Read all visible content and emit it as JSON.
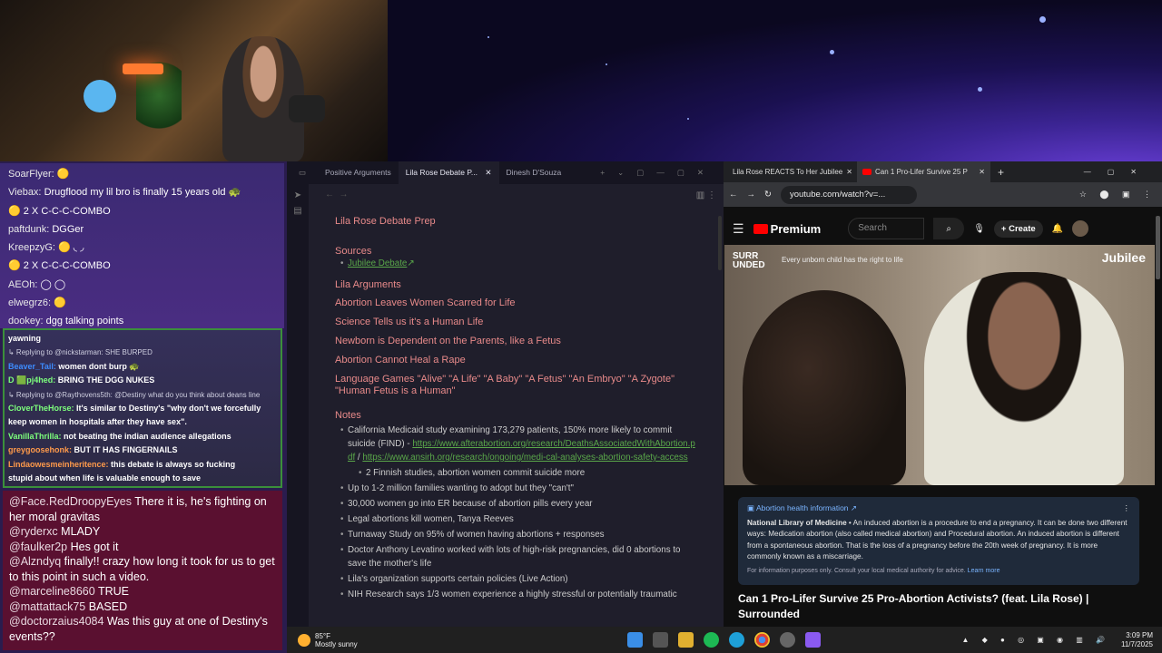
{
  "chat_top": [
    {
      "user": "SoarFlyer:",
      "msg": "🟡"
    },
    {
      "user": "Viebax:",
      "msg": "Drugflood my lil bro is finally 15 years old 🐢"
    },
    {
      "user": "",
      "msg": "🟡 2 X C-C-C-COMBO"
    },
    {
      "user": "paftdunk:",
      "msg": "DGGer"
    },
    {
      "user": "KreepzyG:",
      "msg": "🟡 ◟ ◞"
    },
    {
      "user": "",
      "msg": "🟡 2 X C-C-C-COMBO"
    },
    {
      "user": "AEOh:",
      "msg": "◯ ◯"
    },
    {
      "user": "elwegrz6:",
      "msg": "🟡"
    },
    {
      "user": "dookey:",
      "msg": "dgg talking points"
    }
  ],
  "chat_mid": [
    {
      "user": "yawning",
      "msg": "",
      "color": "#ffffff"
    },
    {
      "reply": "↳ Replying to @nickstarman: SHE BURPED"
    },
    {
      "user": "Beaver_Tail:",
      "msg": "women dont burp 🐢",
      "color": "#3d8cff"
    },
    {
      "user": "D 🟩pj4hed:",
      "msg": "BRING THE DGG NUKES",
      "color": "#7dff7d"
    },
    {
      "reply": "↳ Replying to @Raythovens5th: @Destiny what do you think about deans line"
    },
    {
      "user": "CloverTheHorse:",
      "msg": "It's similar to Destiny's \"why don't we forcefully",
      "color": "#7dff7d"
    },
    {
      "user": "",
      "msg": "keep women in hospitals after they have sex\".",
      "color": "#ffffff"
    },
    {
      "user": "VanillaThrilla:",
      "msg": "not beating the indian audience allegations",
      "color": "#7dff7d"
    },
    {
      "user": "greygoosehonk:",
      "msg": "BUT IT HAS FINGERNAILS",
      "color": "#ff9a4a"
    },
    {
      "user": "Lindaowesmeinheritence:",
      "msg": "this debate is always so fucking",
      "color": "#ff9a4a"
    },
    {
      "user": "",
      "msg": "stupid about when life is valuable enough to save",
      "color": "#ffffff"
    }
  ],
  "chat_bottom": [
    {
      "user": "@Face.RedDroopyEyes",
      "msg": "There it is, he's fighting on her moral gravitas"
    },
    {
      "user": "@ryderxc",
      "msg": "MLADY"
    },
    {
      "user": "@faulker2p",
      "msg": "Hes got it"
    },
    {
      "user": "@Alzndyq",
      "msg": "finally!! crazy how long it took for us to get to this point in such a video."
    },
    {
      "user": "@marceline8660",
      "msg": "TRUE"
    },
    {
      "user": "@mattattack75",
      "msg": "BASED"
    },
    {
      "user": "@doctorzaius4084",
      "msg": "Was this guy at one of Destiny's events??"
    }
  ],
  "notes": {
    "tabs": [
      "Positive Arguments",
      "Lila Rose Debate P...",
      "Dinesh D'Souza"
    ],
    "title": "Lila Rose Debate Prep",
    "sources_heading": "Sources",
    "source_link": "Jubilee Debate",
    "arguments_heading": "Lila Arguments",
    "arguments": [
      "Abortion Leaves Women Scarred for Life",
      "Science Tells us it's a Human Life",
      "Newborn is Dependent on the Parents, like a Fetus",
      "Abortion Cannot Heal a Rape",
      "Language Games \"Alive\" \"A Life\" \"A Baby\" \"A Fetus\" \"An Embryo\" \"A Zygote\" \"Human Fetus is a Human\""
    ],
    "notes_heading": "Notes",
    "note1": "California Medicaid study examining 173,279 patients, 150% more likely to commit suicide (FIND) -",
    "note1_link1": "https://www.afterabortion.org/research/DeathsAssociatedWithAbortion.pdf",
    "note1_sep": "/",
    "note1_link2": "https://www.ansirh.org/research/ongoing/medi-cal-analyses-abortion-safety-access",
    "subnote": "2 Finnish studies, abortion women commit suicide more",
    "notes_list": [
      "Up to 1-2 million families wanting to adopt but they \"can't\"",
      "30,000 women go into ER because of abortion pills every year",
      "Legal abortions kill women, Tanya Reeves",
      "Turnaway Study on 95% of women having abortions + responses",
      "Doctor Anthony Levatino worked with lots of high-risk pregnancies, did 0 abortions to save the mother's life",
      "Lila's organization supports certain policies (Live Action)",
      "NIH Research says 1/3 women experience a highly stressful or potentially traumatic"
    ]
  },
  "browser": {
    "tabs": [
      "Lila Rose REACTS To Her Jubilee",
      "Can 1 Pro-Lifer Survive 25 P"
    ],
    "url": "youtube.com/watch?v=...",
    "logo": "Premium",
    "search_placeholder": "Search",
    "create": "Create",
    "video_tag": "SURR\nUNDED",
    "video_tagline": "Every unborn child has the right to life",
    "video_brand": "Jubilee",
    "info_title": "Abortion health information ↗",
    "info_source": "National Library of Medicine",
    "info_text": "• An induced abortion is a procedure to end a pregnancy. It can be done two different ways: Medication abortion (also called medical abortion) and Procedural abortion. An induced abortion is different from a spontaneous abortion. That is the loss of a pregnancy before the 20th week of pregnancy. It is more commonly known as a miscarriage.",
    "info_fine": "For information purposes only. Consult your local medical authority for advice.",
    "info_learn": "Learn more",
    "video_title": "Can 1 Pro-Lifer Survive 25 Pro-Abortion Activists? (feat. Lila Rose) | Surrounded"
  },
  "taskbar": {
    "temp": "85°F",
    "weather": "Mostly sunny",
    "time": "3:09 PM",
    "date": "11/7/2025"
  }
}
